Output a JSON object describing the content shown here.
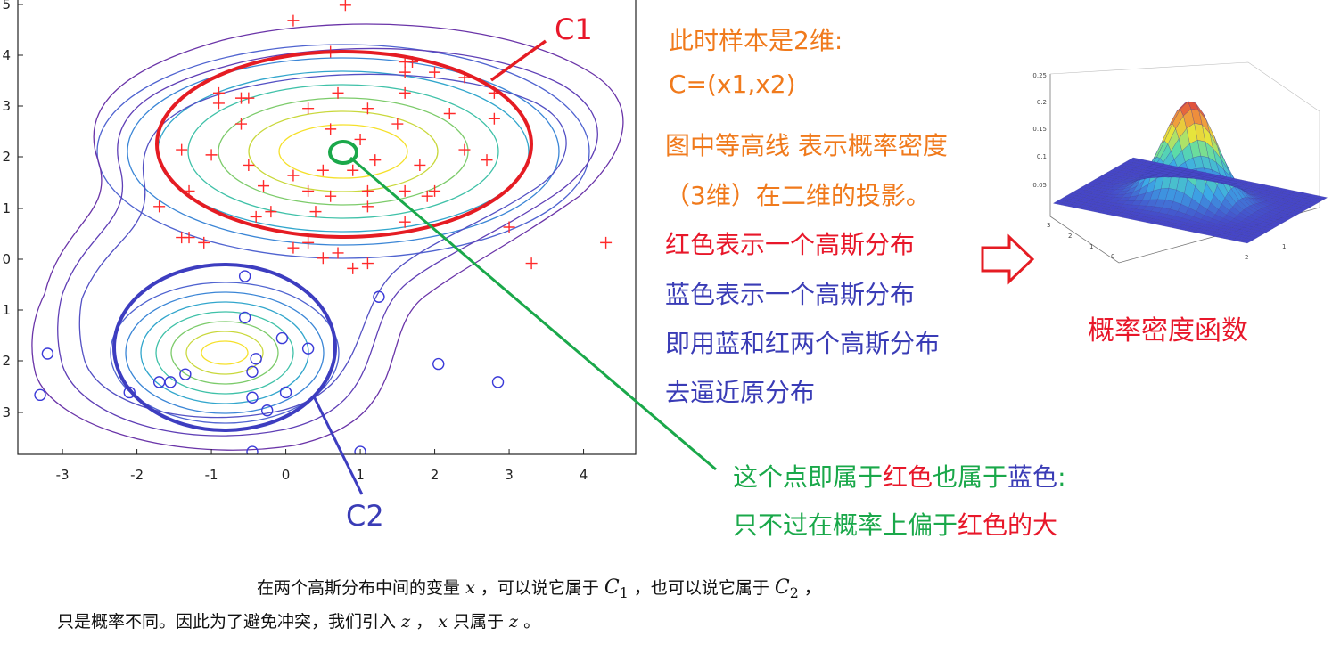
{
  "chart_data": {
    "type": "scatter",
    "x_ticks": [
      "-3",
      "-2",
      "-1",
      "0",
      "1",
      "2",
      "3",
      "4"
    ],
    "y_ticks": [
      "5",
      "4",
      "3",
      "2",
      "1",
      "0",
      "1",
      "2",
      "3"
    ],
    "xlim": [
      -3.6,
      4.7
    ],
    "ylim": [
      -3.8,
      5.0
    ],
    "red_series": {
      "marker": "+",
      "color": "#ff2a2a",
      "points": [
        [
          0.8,
          4.9
        ],
        [
          0.6,
          4.0
        ],
        [
          0.1,
          4.6
        ],
        [
          1.6,
          3.8
        ],
        [
          1.7,
          3.8
        ],
        [
          1.6,
          3.6
        ],
        [
          2.0,
          3.6
        ],
        [
          2.4,
          3.5
        ],
        [
          -0.9,
          3.2
        ],
        [
          -0.9,
          3.0
        ],
        [
          -0.6,
          3.1
        ],
        [
          -0.5,
          3.1
        ],
        [
          0.7,
          3.2
        ],
        [
          1.6,
          3.2
        ],
        [
          2.8,
          3.2
        ],
        [
          0.3,
          2.9
        ],
        [
          1.1,
          2.9
        ],
        [
          2.2,
          2.8
        ],
        [
          2.8,
          2.7
        ],
        [
          -0.6,
          2.6
        ],
        [
          0.6,
          2.5
        ],
        [
          1.5,
          2.6
        ],
        [
          1.0,
          2.3
        ],
        [
          -1.4,
          2.1
        ],
        [
          -1.0,
          2.0
        ],
        [
          -0.5,
          1.8
        ],
        [
          0.1,
          1.6
        ],
        [
          0.5,
          1.7
        ],
        [
          0.9,
          1.7
        ],
        [
          1.2,
          1.9
        ],
        [
          1.8,
          1.8
        ],
        [
          2.4,
          2.1
        ],
        [
          2.7,
          1.9
        ],
        [
          -0.3,
          1.4
        ],
        [
          0.3,
          1.3
        ],
        [
          0.6,
          1.2
        ],
        [
          1.1,
          1.3
        ],
        [
          1.6,
          1.3
        ],
        [
          2.0,
          1.3
        ],
        [
          -1.3,
          1.3
        ],
        [
          -1.7,
          1.0
        ],
        [
          -0.4,
          0.8
        ],
        [
          -0.2,
          0.9
        ],
        [
          0.4,
          0.9
        ],
        [
          1.1,
          1.0
        ],
        [
          1.6,
          0.7
        ],
        [
          1.9,
          1.2
        ],
        [
          3.0,
          0.6
        ],
        [
          -1.4,
          0.4
        ],
        [
          -1.3,
          0.4
        ],
        [
          -1.1,
          0.3
        ],
        [
          0.1,
          0.2
        ],
        [
          0.3,
          0.3
        ],
        [
          0.5,
          0.0
        ],
        [
          0.7,
          0.1
        ],
        [
          0.9,
          -0.2
        ],
        [
          1.1,
          -0.1
        ],
        [
          3.3,
          -0.1
        ],
        [
          4.3,
          0.3
        ]
      ]
    },
    "blue_series": {
      "marker": "o",
      "color": "#3a3ad8",
      "points": [
        [
          -0.55,
          -0.35
        ],
        [
          -0.55,
          -1.15
        ],
        [
          -0.05,
          -1.55
        ],
        [
          0.3,
          -1.75
        ],
        [
          -0.4,
          -1.95
        ],
        [
          -0.45,
          -2.2
        ],
        [
          -1.35,
          -2.25
        ],
        [
          -1.55,
          -2.4
        ],
        [
          -1.7,
          -2.4
        ],
        [
          -2.1,
          -2.6
        ],
        [
          -0.45,
          -2.7
        ],
        [
          0.0,
          -2.6
        ],
        [
          -0.25,
          -2.95
        ],
        [
          -3.2,
          -1.85
        ],
        [
          -3.3,
          -2.65
        ],
        [
          1.25,
          -0.75
        ],
        [
          2.05,
          -2.05
        ],
        [
          2.85,
          -2.4
        ],
        [
          -0.45,
          -3.75
        ],
        [
          1.0,
          -3.75
        ]
      ]
    },
    "clusters": [
      {
        "label": "C1",
        "mean": [
          0.7,
          2.1
        ]
      },
      {
        "label": "C2",
        "mean": [
          -0.8,
          -1.8
        ]
      }
    ]
  },
  "labels": {
    "c1": "C1",
    "c2": "C2"
  },
  "notes": {
    "line1": "此时样本是2维:",
    "line2": "C=(x1,x2)",
    "line3": "图中等高线 表示概率密度",
    "line4": "（3维）在二维的投影。",
    "line5": "红色表示一个高斯分布",
    "line6": "蓝色表示一个高斯分布",
    "line7": "即用蓝和红两个高斯分布",
    "line8": "去逼近原分布",
    "pdf_label": "概率密度函数"
  },
  "green_note": {
    "p1": "这个点即属于",
    "red1": "红色",
    "p2": "也属于",
    "blue1": "蓝色",
    "p3": ":",
    "q1": "只不过在概率上偏于",
    "red2": "红色",
    "q2": "的大"
  },
  "surface_ticks": {
    "z": [
      "0.25",
      "0.2",
      "0.15",
      "0.1",
      "0.05"
    ],
    "front": [
      "3",
      "2",
      "1",
      "0"
    ],
    "side": [
      "2",
      "1"
    ]
  },
  "bottom_text": {
    "a": "在两个高斯分布中间的变量",
    "var_x": "x",
    "b": "，可以说它属于",
    "c1": "C",
    "c1_sub": "1",
    "c": "，也可以说它属于",
    "c2": "C",
    "c2_sub": "2",
    "d": "，",
    "e": "只是概率不同。因此为了避免冲突，我们引入",
    "var_z": "z",
    "f": "，",
    "var_x2": "x",
    "g": "只属于",
    "var_z2": "z",
    "h": "。"
  }
}
